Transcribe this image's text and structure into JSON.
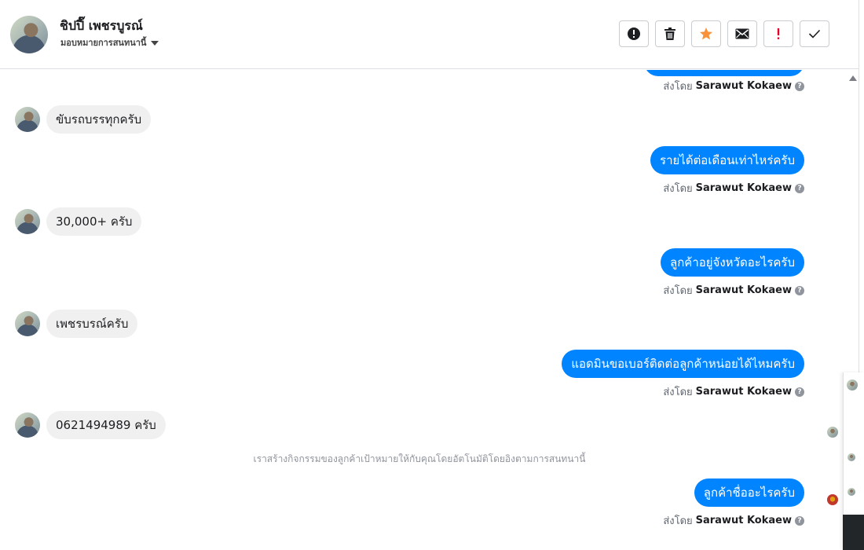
{
  "header": {
    "name": "ชิปปี๊ เพชรบูรณ์",
    "assign_label": "มอบหมายการสนทนานี้",
    "toolbar": [
      {
        "name": "spam-button",
        "icon": "exclamation-circle-icon"
      },
      {
        "name": "delete-button",
        "icon": "trash-icon"
      },
      {
        "name": "star-button",
        "icon": "star-icon"
      },
      {
        "name": "mark-unread-button",
        "icon": "envelope-icon"
      },
      {
        "name": "follow-up-button",
        "icon": "exclamation-icon"
      },
      {
        "name": "mark-done-button",
        "icon": "check-icon"
      }
    ]
  },
  "messages": {
    "sent_by_prefix": "ส่งโดย",
    "agent": "Sarawut Kokaew",
    "m1": "ขับรถบรรทุกครับ",
    "m2": "รายได้ต่อเดือนเท่าไหร่ครับ",
    "m3": "30,000+ ครับ",
    "m4": "ลูกค้าอยู่จังหวัดอะไรครับ",
    "m5": "เพชรบรณ์ครับ",
    "m6": "แอดมินขอเบอร์ติดต่อลูกค้าหน่อยได้ไหมครับ",
    "m7": "0621494989 ครับ",
    "system_note": "เราสร้างกิจกรรมของลูกค้าเป้าหมายให้กับคุณโดยอัตโนมัติโดยอิงตามการสนทนานี้",
    "m8": "ลูกค้าชื่ออะไรครับ"
  },
  "colors": {
    "outgoing_bubble": "#0084ff",
    "incoming_bubble": "#f0f0f0",
    "star": "#f7923a",
    "follow_up": "#e4002b"
  }
}
